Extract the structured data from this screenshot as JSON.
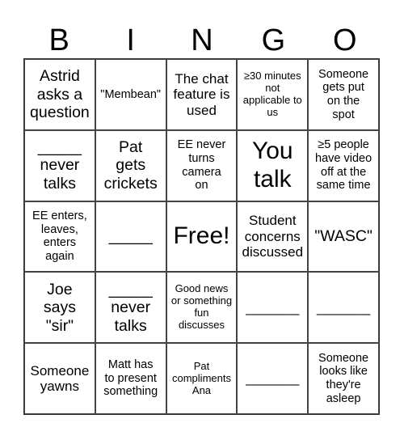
{
  "header": [
    "B",
    "I",
    "N",
    "G",
    "O"
  ],
  "cells": [
    {
      "text": "Astrid\nasks a\nquestion",
      "size": "lg"
    },
    {
      "text": "\"Membean\"",
      "size": "sm"
    },
    {
      "text": "The chat\nfeature is\nused",
      "size": "md"
    },
    {
      "text": "≥30 minutes\nnot\napplicable to\nus",
      "size": "xs"
    },
    {
      "text": "Someone\ngets put\non the\nspot",
      "size": "sm"
    },
    {
      "text": "_____\nnever\ntalks",
      "size": "lg"
    },
    {
      "text": "Pat\ngets\ncrickets",
      "size": "lg"
    },
    {
      "text": "EE never\nturns\ncamera\non",
      "size": "sm"
    },
    {
      "text": "You\ntalk",
      "size": "xl"
    },
    {
      "text": "≥5 people\nhave video\noff at the\nsame time",
      "size": "sm"
    },
    {
      "text": "EE enters,\nleaves,\nenters\nagain",
      "size": "sm"
    },
    {
      "text": "_____",
      "size": "lg"
    },
    {
      "text": "Free!",
      "size": "xl"
    },
    {
      "text": "Student\nconcerns\ndiscussed",
      "size": "md"
    },
    {
      "text": "\"WASC\"",
      "size": "lg"
    },
    {
      "text": "Joe\nsays\n\"sir\"",
      "size": "lg"
    },
    {
      "text": "_____\nnever\ntalks",
      "size": "lg"
    },
    {
      "text": "Good news\nor something\nfun\ndiscusses",
      "size": "xs"
    },
    {
      "text": "_______",
      "size": "md"
    },
    {
      "text": "_______",
      "size": "md"
    },
    {
      "text": "Someone\nyawns",
      "size": "md"
    },
    {
      "text": "Matt has\nto present\nsomething",
      "size": "sm"
    },
    {
      "text": "Pat\ncompliments\nAna",
      "size": "xs"
    },
    {
      "text": "_______",
      "size": "md"
    },
    {
      "text": "Someone\nlooks like\nthey're\nasleep",
      "size": "sm"
    }
  ]
}
